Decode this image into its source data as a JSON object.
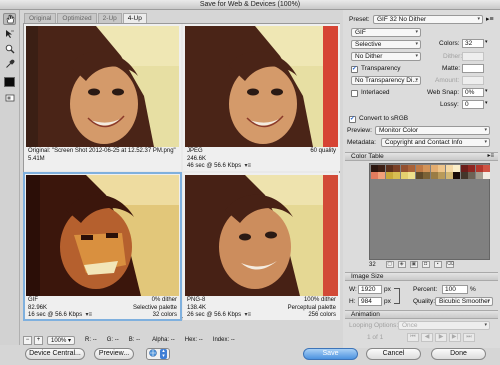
{
  "window": {
    "title": "Save for Web & Devices (100%)"
  },
  "view_tabs": [
    "Original",
    "Optimized",
    "2-Up",
    "4-Up"
  ],
  "panes": [
    {
      "line1_left": "Original: \"Screen Shot 2012-06-25 at 12.52.37 PM.png\"",
      "line2_left": "5.41M",
      "line3_left": "",
      "line1_right": "",
      "line2_right": "",
      "line3_right": ""
    },
    {
      "line1_left": "JPEG",
      "line2_left": "246.6K",
      "line3_left": "46 sec @ 56.6 Kbps",
      "line1_right": "60 quality",
      "line2_right": "",
      "line3_right": ""
    },
    {
      "line1_left": "GIF",
      "line2_left": "82.96K",
      "line3_left": "16 sec @ 56.6 Kbps",
      "line1_right": "0% dither",
      "line2_right": "Selective palette",
      "line3_right": "32 colors"
    },
    {
      "line1_left": "PNG-8",
      "line2_left": "138.4K",
      "line3_left": "26 sec @ 56.6 Kbps",
      "line1_right": "100% dither",
      "line2_right": "Perceptual palette",
      "line3_right": "256 colors"
    }
  ],
  "status_bar": {
    "zoom": "100%",
    "r_label": "R:",
    "r_value": "--",
    "g_label": "G:",
    "g_value": "--",
    "b_label": "B:",
    "b_value": "--",
    "alpha_label": "Alpha:",
    "alpha_value": "--",
    "hex_label": "Hex:",
    "hex_value": "--",
    "index_label": "Index:",
    "index_value": "--"
  },
  "buttons": {
    "device_central": "Device Central...",
    "preview": "Preview...",
    "save": "Save",
    "cancel": "Cancel",
    "done": "Done"
  },
  "settings": {
    "preset_label": "Preset:",
    "preset_value": "GIF 32 No Dither",
    "format": "GIF",
    "reduction": "Selective",
    "colors_label": "Colors:",
    "colors_value": "32",
    "dither_algo": "No Dither",
    "dither_label": "Dither:",
    "transparency_label": "Transparency",
    "transparency_checked": true,
    "matte_label": "Matte:",
    "transparency_dither": "No Transparency Di...",
    "amount_label": "Amount:",
    "interlaced_label": "Interlaced",
    "interlaced_checked": false,
    "web_snap_label": "Web Snap:",
    "web_snap_value": "0%",
    "lossy_label": "Lossy:",
    "lossy_value": "0",
    "convert_srgb_label": "Convert to sRGB",
    "convert_srgb_checked": true,
    "preview_label": "Preview:",
    "preview_value": "Monitor Color",
    "metadata_label": "Metadata:",
    "metadata_value": "Copyright and Contact Info"
  },
  "color_table": {
    "title": "Color Table",
    "count": "32",
    "colors": [
      "#2b160f",
      "#3d1f14",
      "#5a2f1c",
      "#7a4026",
      "#93502f",
      "#a96238",
      "#c07a45",
      "#d39459",
      "#e3ad70",
      "#efc58a",
      "#f5d9a6",
      "#fbeec9",
      "#6b1d1a",
      "#8f2621",
      "#b3372c",
      "#cf5444",
      "#e27c5e",
      "#f1a07a",
      "#c9a93a",
      "#d8bd52",
      "#e4d06e",
      "#eee08c",
      "#5f4a2a",
      "#7b6236",
      "#9a7c45",
      "#b99a5a",
      "#d2b774",
      "#1a0c08",
      "#44362a",
      "#6d6355",
      "#a59e8f",
      "#f2ede2"
    ]
  },
  "image_size": {
    "title": "Image Size",
    "w_label": "W:",
    "w_value": "1920",
    "w_unit": "px",
    "h_label": "H:",
    "h_value": "984",
    "h_unit": "px",
    "percent_label": "Percent:",
    "percent_value": "100",
    "percent_unit": "%",
    "quality_label": "Quality:",
    "quality_value": "Bicubic Smoother"
  },
  "animation": {
    "title": "Animation",
    "looping_label": "Looping Options:",
    "looping_value": "Once",
    "frame_counter": "1 of 1"
  },
  "icons": [
    "hand-tool-icon",
    "slice-select-icon",
    "zoom-tool-icon",
    "eyedropper-icon",
    "eyedropper-color-swatch",
    "slice-visibility-icon",
    "optimize-menu-icon",
    "color-table-menu-icon",
    "link-chain-icon",
    "browser-icon"
  ]
}
